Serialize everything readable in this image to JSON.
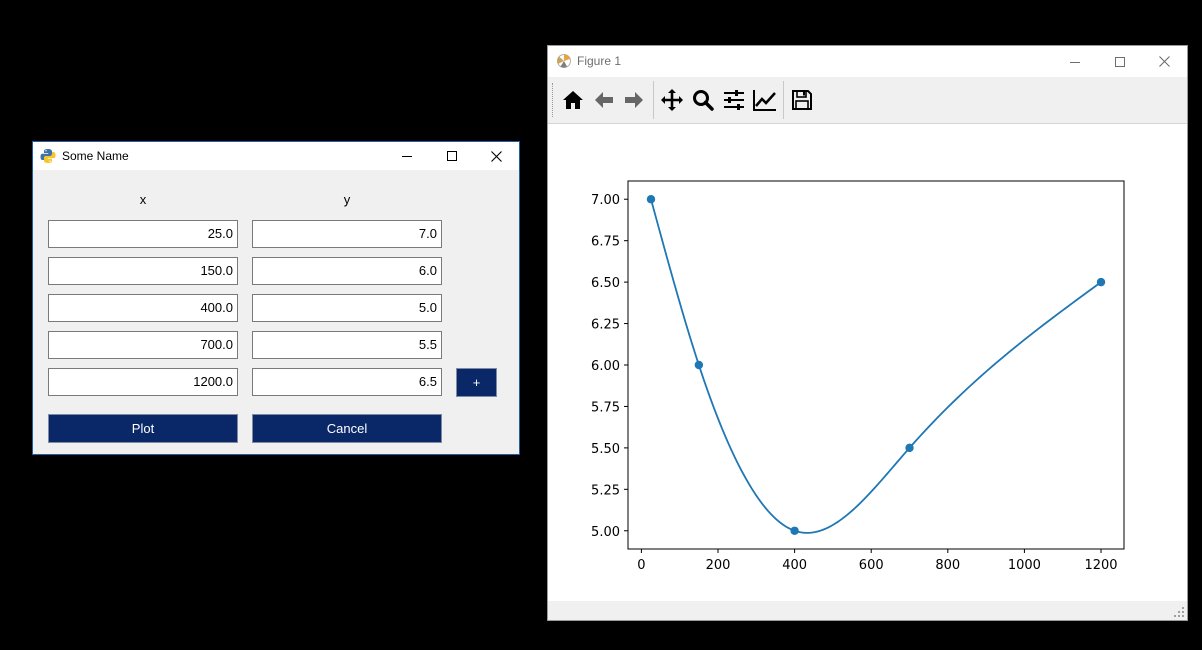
{
  "dialog": {
    "title": "Some Name",
    "col_x": "x",
    "col_y": "y",
    "x_values": [
      "25.0",
      "150.0",
      "400.0",
      "700.0",
      "1200.0"
    ],
    "y_values": [
      "7.0",
      "6.0",
      "5.0",
      "5.5",
      "6.5"
    ],
    "add_label": "+",
    "plot_label": "Plot",
    "cancel_label": "Cancel",
    "button_color": "#0a2867"
  },
  "figure": {
    "title": "Figure 1",
    "toolbar_icons": [
      "home-icon",
      "back-arrow-icon",
      "forward-arrow-icon",
      "pan-icon",
      "zoom-icon",
      "subplots-icon",
      "edit-curves-icon",
      "save-icon"
    ]
  },
  "chart_data": {
    "type": "line",
    "x": [
      25,
      150,
      400,
      700,
      1200
    ],
    "y": [
      7.0,
      6.0,
      5.0,
      5.5,
      6.5
    ],
    "curve": "smooth-interpolated",
    "markers": true,
    "color": "#1f77b4",
    "xlim": [
      -35,
      1260
    ],
    "ylim": [
      4.89,
      7.11
    ],
    "xticks": [
      0,
      200,
      400,
      600,
      800,
      1000,
      1200
    ],
    "yticks": [
      "5.00",
      "5.25",
      "5.50",
      "5.75",
      "6.00",
      "6.25",
      "6.50",
      "6.75",
      "7.00"
    ],
    "grid": false
  }
}
